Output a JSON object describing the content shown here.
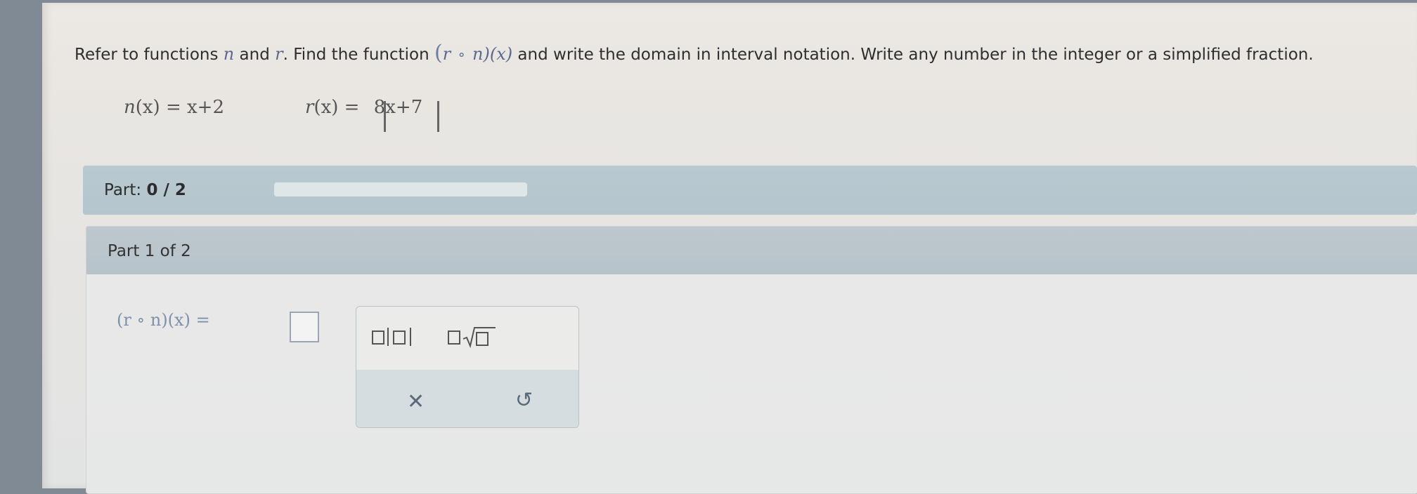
{
  "question": {
    "text_a": "Refer to functions",
    "fn1": "n",
    "text_and": "and",
    "fn2": "r",
    "text_b": ". Find the function",
    "comp_l": "(",
    "comp_r": "r",
    "comp_circ": "∘",
    "comp_n": "n",
    "comp_close": ")(x)",
    "text_c": "and write the domain in interval notation. Write any number in the integer or a simplified fraction."
  },
  "functions": {
    "n_def_left": "n",
    "n_def_x": "(x)",
    "n_def_right": " = x+2",
    "r_def_left": "r",
    "r_def_x": "(x)",
    "r_def_eq": " = ",
    "r_def_abs": "8x+7"
  },
  "progress": {
    "label": "Part:",
    "value": "0 / 2",
    "fraction": 0.0
  },
  "part1": {
    "label": "Part 1 of 2",
    "answer_lhs": "(r ∘ n)(x) ="
  },
  "toolbox": {
    "tools": [
      "absolute-value",
      "square-root"
    ],
    "clear_glyph": "✕",
    "undo_glyph": "↺"
  },
  "colors": {
    "part_bar": "#b4c5cd",
    "math": "#5a6a8e"
  }
}
